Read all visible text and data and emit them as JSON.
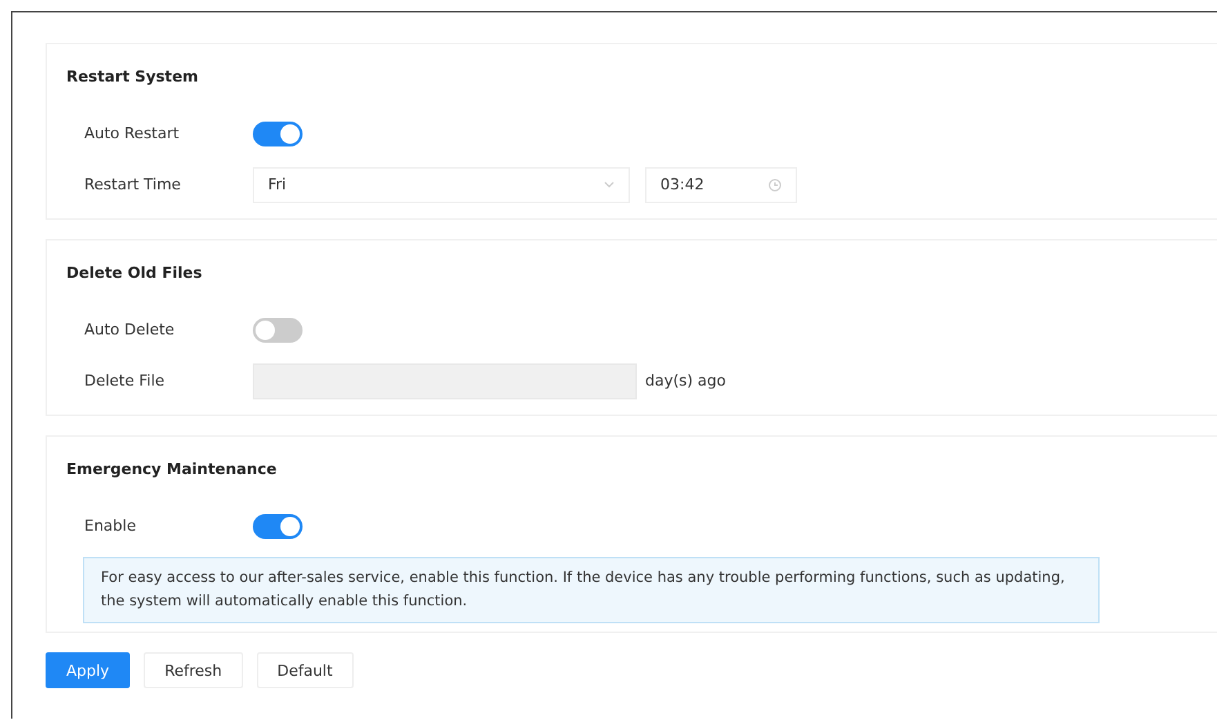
{
  "sections": [
    {
      "title": "Restart System",
      "rows": [
        {
          "kind": "toggle",
          "label": "Auto Restart",
          "on": true
        },
        {
          "kind": "select_time",
          "label": "Restart Time",
          "value": "Fri",
          "time": "03:42"
        }
      ]
    },
    {
      "title": "Delete Old Files",
      "rows": [
        {
          "kind": "toggle",
          "label": "Auto Delete",
          "on": false
        },
        {
          "kind": "number",
          "label": "Delete File",
          "disabled": true,
          "suffix": "day(s) ago"
        }
      ]
    },
    {
      "title": "Emergency Maintenance",
      "rows": [
        {
          "kind": "toggle",
          "label": "Enable",
          "on": true
        }
      ],
      "notice": "For easy access to our after-sales service, enable this function. If the device has any trouble performing functions, such as updating, the system will automatically enable this function."
    }
  ],
  "buttons": [
    {
      "label": "Apply",
      "kind": "primary"
    },
    {
      "label": "Refresh",
      "kind": "plain"
    },
    {
      "label": "Default",
      "kind": "plain"
    }
  ]
}
